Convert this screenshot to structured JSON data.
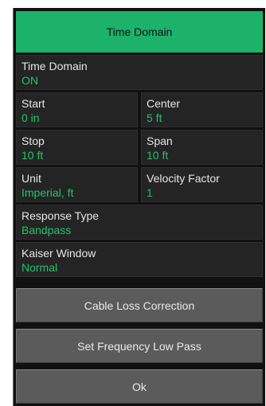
{
  "header": {
    "title": "Time Domain"
  },
  "fields": {
    "time_domain": {
      "label": "Time Domain",
      "value": "ON"
    },
    "start": {
      "label": "Start",
      "value": "0 in"
    },
    "center": {
      "label": "Center",
      "value": "5 ft"
    },
    "stop": {
      "label": "Stop",
      "value": "10 ft"
    },
    "span": {
      "label": "Span",
      "value": "10 ft"
    },
    "unit": {
      "label": "Unit",
      "value": "Imperial, ft"
    },
    "velocity_factor": {
      "label": "Velocity Factor",
      "value": "1"
    },
    "response_type": {
      "label": "Response Type",
      "value": "Bandpass"
    },
    "kaiser_window": {
      "label": "Kaiser Window",
      "value": "Normal"
    }
  },
  "buttons": {
    "cable_loss": "Cable Loss Correction",
    "set_freq_low_pass": "Set Frequency Low Pass",
    "ok": "Ok"
  },
  "colors": {
    "accent": "#1cb26a",
    "value_text": "#22c36f",
    "panel_bg": "#111111",
    "cell_bg": "#242424",
    "button_bg": "#5b5b5b"
  }
}
